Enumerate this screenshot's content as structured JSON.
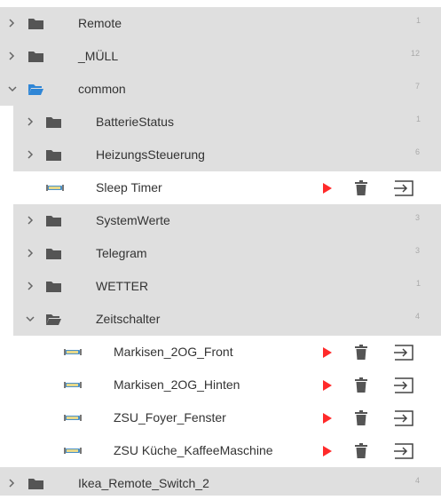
{
  "colors": {
    "folder_bg": "#dfdfdf",
    "play": "#ff2a2a",
    "icon": "#555555",
    "folder_open": "#2f86d6"
  },
  "icons": {
    "folder": "folder-icon",
    "folder_open": "folder-open-icon",
    "script": "script-icon",
    "run": "play-icon",
    "delete": "trash-icon",
    "export": "export-icon",
    "chevron_right": "chevron-right-icon",
    "chevron_down": "chevron-down-icon"
  },
  "tree": {
    "remote": {
      "label": "Remote",
      "count": "1"
    },
    "muell": {
      "label": "_MÜLL",
      "count": "12"
    },
    "common": {
      "label": "common",
      "count": "7"
    },
    "batterie": {
      "label": "BatterieStatus",
      "count": "1"
    },
    "heizung": {
      "label": "HeizungsSteuerung",
      "count": "6"
    },
    "sleep": {
      "label": "Sleep Timer"
    },
    "system": {
      "label": "SystemWerte",
      "count": "3"
    },
    "telegram": {
      "label": "Telegram",
      "count": "3"
    },
    "wetter": {
      "label": "WETTER",
      "count": "1"
    },
    "zeit": {
      "label": "Zeitschalter",
      "count": "4"
    },
    "mfront": {
      "label": "Markisen_2OG_Front"
    },
    "mhinten": {
      "label": "Markisen_2OG_Hinten"
    },
    "zsuf": {
      "label": "ZSU_Foyer_Fenster"
    },
    "zsuk": {
      "label": "ZSU Küche_KaffeeMaschine"
    },
    "ikea": {
      "label": "Ikea_Remote_Switch_2",
      "count": "4"
    }
  }
}
